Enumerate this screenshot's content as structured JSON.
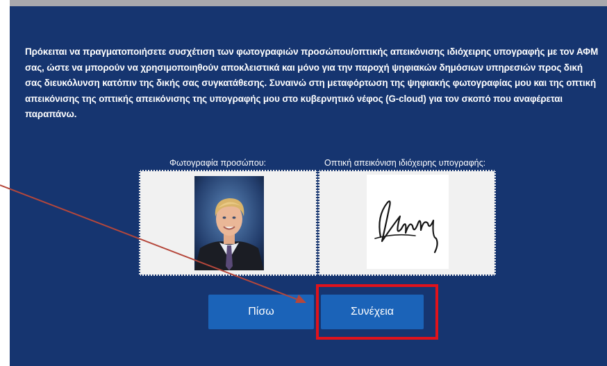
{
  "consent": {
    "text": "Πρόκειται να πραγματοποιήσετε συσχέτιση των φωτογραφιών προσώπου/οπτικής απεικόνισης ιδιόχειρης υπογραφής με τον ΑΦΜ σας, ώστε να μπορούν να χρησιμοποιηθούν αποκλειστικά και μόνο για την παροχή ψηφιακών δημόσιων υπηρεσιών προς δική σας διευκόλυνση κατόπιν της δικής σας συγκατάθεσης. Συναινώ στη μεταφόρτωση της ψηφιακής φωτογραφίας μου και της οπτική απεικόνισης της οπτικής απεικόνισης της υπογραφής μου στο κυβερνητικό νέφος (G-cloud) για τον σκοπό που αναφέρεται παραπάνω."
  },
  "photo": {
    "label": "Φωτογραφία προσώπου:"
  },
  "signature": {
    "label": "Οπτική απεικόνιση ιδιόχειρης υπογραφής:"
  },
  "buttons": {
    "back": "Πίσω",
    "continue": "Συνέχεια"
  },
  "colors": {
    "panel": "#163570",
    "button": "#1b63b8",
    "highlight": "#e0121b",
    "arrow": "#b5473b"
  }
}
